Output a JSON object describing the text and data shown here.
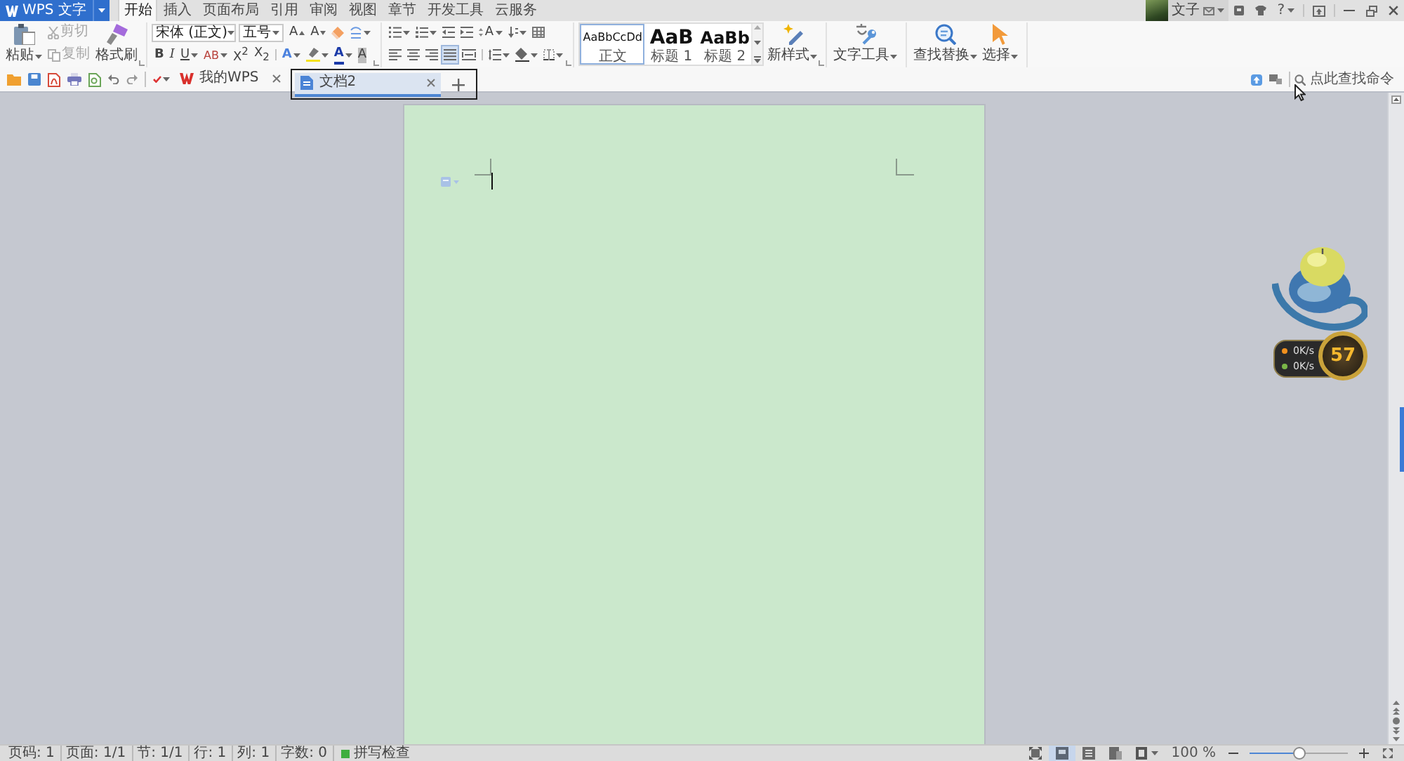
{
  "title_bar": {
    "app_menu": "WPS 文字",
    "tabs": [
      {
        "label": "开始",
        "selected": true
      },
      {
        "label": "插入",
        "selected": false
      },
      {
        "label": "页面布局",
        "selected": false
      },
      {
        "label": "引用",
        "selected": false
      },
      {
        "label": "审阅",
        "selected": false
      },
      {
        "label": "视图",
        "selected": false
      },
      {
        "label": "章节",
        "selected": false
      },
      {
        "label": "开发工具",
        "selected": false
      },
      {
        "label": "云服务",
        "selected": false
      }
    ],
    "account": {
      "name": "文子"
    },
    "help": "?"
  },
  "ribbon": {
    "clipboard": {
      "paste": "粘贴",
      "cut": {
        "label": "剪切",
        "disabled": true
      },
      "copy": {
        "label": "复制",
        "disabled": true
      },
      "format_painter": "格式刷"
    },
    "font": {
      "family": "宋体 (正文)",
      "size": "五号",
      "grow": "A",
      "shrink": "A",
      "bold": "B",
      "italic": "I",
      "underline": "U",
      "strike": "AB",
      "superscript": "X$^{2}$",
      "subscript": "X$_{2}$",
      "effect": "A",
      "font_color": "A",
      "shading": "A"
    },
    "paragraph": {
      "direction": "A",
      "align": [
        {
          "selected": false
        },
        {
          "selected": false
        },
        {
          "selected": false
        },
        {
          "selected": true
        },
        {
          "selected": false
        }
      ]
    },
    "styles": [
      {
        "preview": "AaBbCcDd",
        "label": "正文",
        "selected": true
      },
      {
        "preview": "AaB",
        "label": "标题 1",
        "selected": false
      },
      {
        "preview": "AaBb",
        "label": "标题 2",
        "selected": false
      }
    ],
    "new_style": "新样式",
    "text_tools": "文字工具",
    "find_replace": "查找替换",
    "select": "选择"
  },
  "quick_bar": {
    "doc_tabs": [
      {
        "label": "我的WPS",
        "kind": "home",
        "selected": false,
        "highlighted": false
      },
      {
        "label": "文档2",
        "kind": "document",
        "selected": true,
        "highlighted": true
      }
    ],
    "command_search": {
      "placeholder": "点此查找命令"
    }
  },
  "speed_widget": {
    "rates": [
      {
        "text": "0K/s",
        "color": "#f0901e"
      },
      {
        "text": "0K/s",
        "color": "#7ab648"
      }
    ],
    "badge": "57"
  },
  "status_bar": {
    "items": [
      "页码: 1",
      "页面: 1/1",
      "节: 1/1",
      "行: 1",
      "列: 1",
      "字数: 0"
    ],
    "spell_check": {
      "label": "拼写检查",
      "on": true
    },
    "views": [
      {
        "selected": false
      },
      {
        "selected": true
      },
      {
        "selected": false
      },
      {
        "selected": false
      }
    ],
    "zoom": {
      "reading": "100 %",
      "level": 0.5
    }
  }
}
